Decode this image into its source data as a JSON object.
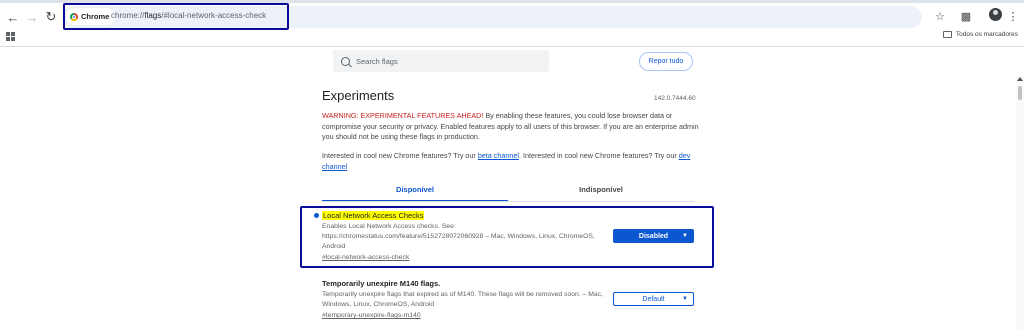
{
  "toolbar": {
    "back_icon": "arrow-left-icon",
    "forward_icon": "arrow-right-icon",
    "reload_icon": "reload-icon",
    "chip_label": "Chrome",
    "url_prefix": "chrome://",
    "url_host": "flags",
    "url_rest": "/#local-network-access-check",
    "star_icon": "star-icon",
    "extensions_icon": "puzzle-icon",
    "menu_icon": "more-vert-icon"
  },
  "bookmarks": {
    "apps_icon": "apps-grid-icon",
    "all_bookmarks_label": "Todos os marcadores"
  },
  "flags_page": {
    "search_placeholder": "Search flags",
    "reset_label": "Repor tudo",
    "title": "Experiments",
    "version": "142.0.7444.60",
    "warning_red": "WARNING: EXPERIMENTAL FEATURES AHEAD!",
    "warning_rest": " By enabling these features, you could lose browser data or compromise your security or privacy. Enabled features apply to all users of this browser. If you are an enterprise admin you should not be using these flags in production.",
    "interest_1": "Interested in cool new Chrome features? Try our ",
    "beta_link": "beta channel",
    "interest_2": ". Interested in cool new Chrome features? Try our ",
    "dev_link": "dev channel",
    "tabs": [
      {
        "label": "Disponível",
        "active": true
      },
      {
        "label": "Indisponível",
        "active": false
      }
    ],
    "flags": [
      {
        "title": "Local Network Access Checks",
        "description": "Enables Local Network Access checks. See: https://chromestatus.com/feature/5152728072060928 – Mac, Windows, Linux, ChromeOS, Android",
        "link": "#local-network-access-check",
        "value": "Disabled"
      },
      {
        "title": "Temporarily unexpire M140 flags.",
        "description": "Temporarily unexpire flags that expired as of M140. These flags will be removed soon. – Mac, Windows, Linux, ChromeOS, Android",
        "link": "#temporary-unexpire-flags-m140",
        "value": "Default"
      }
    ]
  },
  "colors": {
    "accent": "#0b57d0",
    "warning": "#c5221f",
    "highlight": "#ffff00",
    "annotation_box": "#0b0b9a"
  }
}
